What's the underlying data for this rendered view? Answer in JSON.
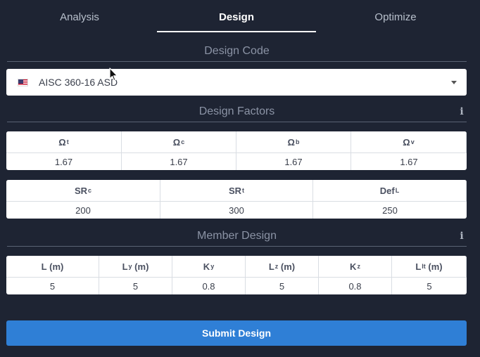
{
  "tabs": [
    {
      "label": "Analysis"
    },
    {
      "label": "Design"
    },
    {
      "label": "Optimize"
    }
  ],
  "design_code": {
    "title": "Design Code",
    "selected": "AISC 360-16 ASD",
    "flag_icon": "us-flag-icon"
  },
  "design_factors": {
    "title": "Design Factors",
    "info_icon": "i",
    "table1": {
      "headers": [
        {
          "base": "Ω",
          "sub": "t"
        },
        {
          "base": "Ω",
          "sub": "c"
        },
        {
          "base": "Ω",
          "sub": "b"
        },
        {
          "base": "Ω",
          "sub": "v"
        }
      ],
      "values": [
        "1.67",
        "1.67",
        "1.67",
        "1.67"
      ]
    },
    "table2": {
      "headers": [
        {
          "base": "SR",
          "sub": "c"
        },
        {
          "base": "SR",
          "sub": "t"
        },
        {
          "base": "Def",
          "sub": "L"
        }
      ],
      "values": [
        "200",
        "300",
        "250"
      ]
    }
  },
  "member_design": {
    "title": "Member Design",
    "info_icon": "i",
    "table": {
      "headers": [
        {
          "base": "L",
          "sub": "",
          "unit": " (m)"
        },
        {
          "base": "L",
          "sub": "y",
          "unit": " (m)"
        },
        {
          "base": "K",
          "sub": "y",
          "unit": ""
        },
        {
          "base": "L",
          "sub": "z",
          "unit": " (m)"
        },
        {
          "base": "K",
          "sub": "z",
          "unit": ""
        },
        {
          "base": "L",
          "sub": "lt",
          "unit": " (m)"
        }
      ],
      "values": [
        "5",
        "5",
        "0.8",
        "5",
        "0.8",
        "5"
      ]
    }
  },
  "submit": {
    "label": "Submit Design"
  },
  "colors": {
    "background": "#1e2433",
    "button": "#2f7fd6"
  }
}
